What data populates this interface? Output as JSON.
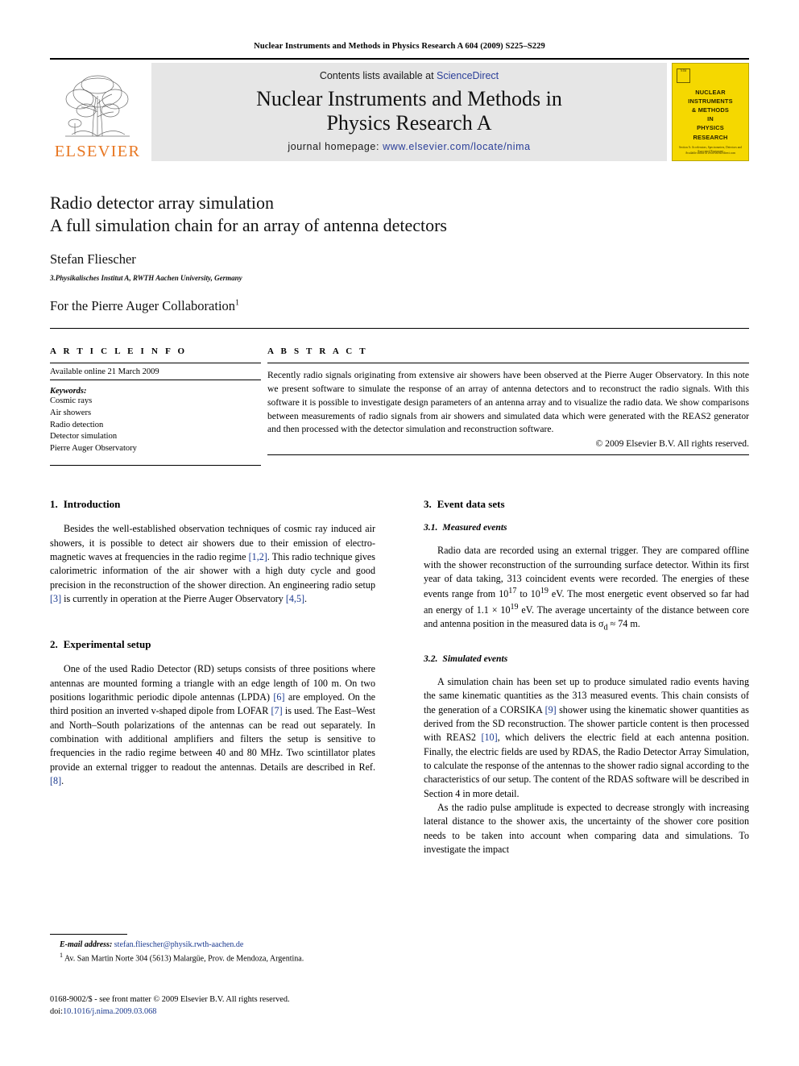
{
  "running_head": "Nuclear Instruments and Methods in Physics Research A 604 (2009) S225–S229",
  "masthead": {
    "publisher": "ELSEVIER",
    "contents_prefix": "Contents lists available at ",
    "contents_link": "ScienceDirect",
    "journal_title_line1": "Nuclear Instruments and Methods in",
    "journal_title_line2": "Physics Research A",
    "homepage_prefix": "journal homepage: ",
    "homepage_url": "www.elsevier.com/locate/nima",
    "cover": {
      "badge": "NIM",
      "title_line1": "NUCLEAR",
      "title_line2": "INSTRUMENTS",
      "title_line3": "& METHODS",
      "title_line4": "IN",
      "title_line5": "PHYSICS",
      "title_line6": "RESEARCH",
      "subtitle": "Section A: Accelerators, Spectrometers, Detectors and Associated Equipment",
      "footer": "Available online at www.sciencedirect.com"
    }
  },
  "title": {
    "line1": "Radio detector array simulation",
    "line2": "A full simulation chain for an array of antenna detectors",
    "author": "Stefan Fliescher",
    "affiliation": "3.Physikalisches Institut A, RWTH Aachen University, Germany",
    "collaboration": "For the Pierre Auger Collaboration",
    "collaboration_sup": "1"
  },
  "article_info": {
    "heading": "A R T I C L E   I N F O",
    "available_online": "Available online 21 March 2009",
    "keywords_label": "Keywords:",
    "keywords": [
      "Cosmic rays",
      "Air showers",
      "Radio detection",
      "Detector simulation",
      "Pierre Auger Observatory"
    ]
  },
  "abstract": {
    "heading": "A B S T R A C T",
    "text": "Recently radio signals originating from extensive air showers have been observed at the Pierre Auger Observatory. In this note we present software to simulate the response of an array of antenna detectors and to reconstruct the radio signals. With this software it is possible to investigate design parameters of an antenna array and to visualize the radio data. We show comparisons between measurements of radio signals from air showers and simulated data which were generated with the REAS2 generator and then processed with the detector simulation and reconstruction software.",
    "copyright": "© 2009 Elsevier B.V. All rights reserved."
  },
  "sections": {
    "intro": {
      "num": "1.",
      "title": "Introduction",
      "p1_a": "Besides the well-established observation techniques of cosmic ray induced air showers, it is possible to detect air showers due to their emission of electro-magnetic waves at frequencies in the radio regime ",
      "p1_ref1": "[1,2]",
      "p1_b": ". This radio technique gives calorimetric information of the air shower with a high duty cycle and good precision in the reconstruction of the shower direction. An engineering radio setup ",
      "p1_ref2": "[3]",
      "p1_c": " is currently in operation at the Pierre Auger Observatory ",
      "p1_ref3": "[4,5]",
      "p1_d": "."
    },
    "experimental": {
      "num": "2.",
      "title": "Experimental setup",
      "p1_a": "One of the used Radio Detector (RD) setups consists of three positions where antennas are mounted forming a triangle with an edge length of 100 m. On two positions logarithmic periodic dipole antennas (LPDA) ",
      "p1_ref1": "[6]",
      "p1_b": " are employed. On the third position an inverted v-shaped dipole from LOFAR ",
      "p1_ref2": "[7]",
      "p1_c": " is used. The East–West and North–South polarizations of the antennas can be read out separately. In combination with additional amplifiers and filters the setup is sensitive to frequencies in the radio regime between 40 and 80 MHz. Two scintillator plates provide an external trigger to readout the antennas. Details are described in Ref. ",
      "p1_ref3": "[8]",
      "p1_d": "."
    },
    "event_data": {
      "num": "3.",
      "title": "Event data sets"
    },
    "measured": {
      "num": "3.1.",
      "title": "Measured events",
      "p1_a": "Radio data are recorded using an external trigger. They are compared offline with the shower reconstruction of the surrounding surface detector. Within its first year of data taking, 313 coincident events were recorded. The energies of these events range from 10",
      "p1_sup1": "17",
      "p1_b": " to 10",
      "p1_sup2": "19",
      "p1_c": " eV. The most energetic event observed so far had an energy of 1.1 × 10",
      "p1_sup3": "19",
      "p1_d": " eV. The average uncertainty of the distance between core and antenna position in the measured data is σ",
      "p1_sub1": "d",
      "p1_e": " ≈ 74 m."
    },
    "simulated": {
      "num": "3.2.",
      "title": "Simulated events",
      "p1_a": "A simulation chain has been set up to produce simulated radio events having the same kinematic quantities as the 313 measured events. This chain consists of the generation of a CORSIKA ",
      "p1_ref1": "[9]",
      "p1_b": " shower using the kinematic shower quantities as derived from the SD reconstruction. The shower particle content is then processed with REAS2 ",
      "p1_ref2": "[10]",
      "p1_c": ", which delivers the electric field at each antenna position. Finally, the electric fields are used by RDAS, the Radio Detector Array Simulation, to calculate the response of the antennas to the shower radio signal according to the characteristics of our setup. The content of the RDAS software will be described in Section 4 in more detail.",
      "p2": "As the radio pulse amplitude is expected to decrease strongly with increasing lateral distance to the shower axis, the uncertainty of the shower core position needs to be taken into account when comparing data and simulations. To investigate the impact"
    }
  },
  "footnotes": {
    "email_label": "E-mail address:",
    "email": "stefan.fliescher@physik.rwth-aachen.de",
    "note_marker": "1",
    "note_text": "Av. San Martin Norte 304 (5613) Malargüe, Prov. de Mendoza, Argentina."
  },
  "imprint": {
    "line1": "0168-9002/$ - see front matter © 2009 Elsevier B.V. All rights reserved.",
    "doi_label": "doi:",
    "doi_value": "10.1016/j.nima.2009.03.068"
  },
  "colors": {
    "link_blue": "#2b3f99",
    "reference_blue": "#1b3a8f",
    "elsevier_orange": "#E87722",
    "banner_gray": "#e6e6e6",
    "cover_yellow": "#F5D800"
  }
}
